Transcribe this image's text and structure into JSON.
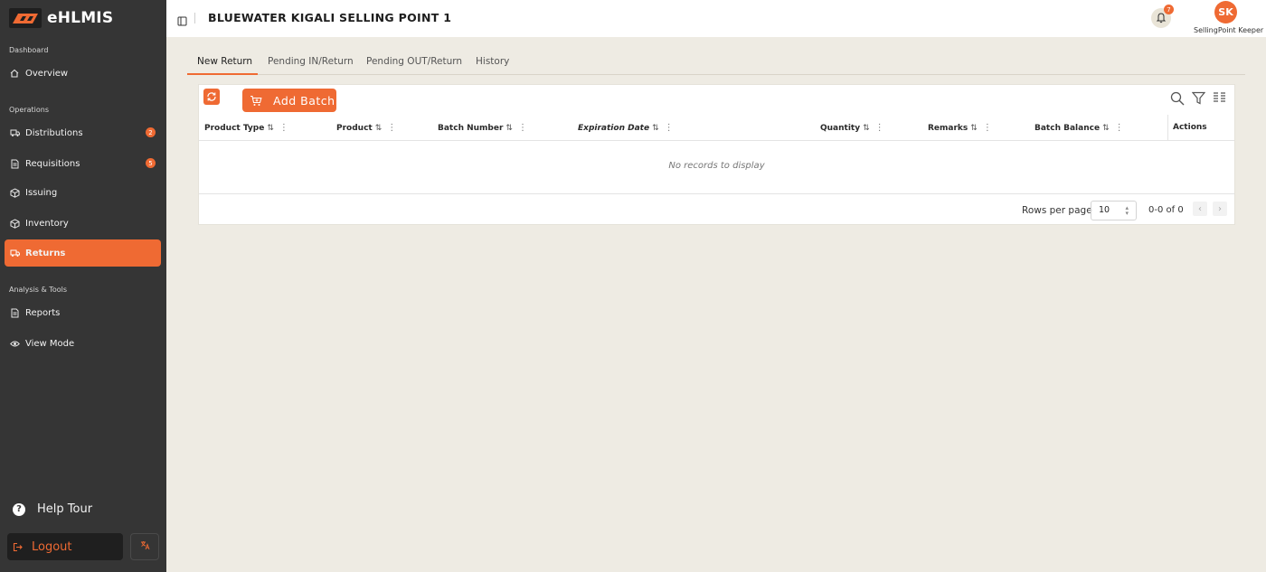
{
  "app": {
    "name": "eHLMIS"
  },
  "sidebar": {
    "sections": [
      {
        "title": "Dashboard"
      },
      {
        "title": "Operations"
      },
      {
        "title": "Analysis & Tools"
      }
    ],
    "items": [
      {
        "label": "Overview",
        "icon": "home-icon"
      },
      {
        "label": "Distributions",
        "icon": "truck-icon",
        "badge": "2"
      },
      {
        "label": "Requisitions",
        "icon": "document-icon",
        "badge": "5"
      },
      {
        "label": "Issuing",
        "icon": "box-icon"
      },
      {
        "label": "Inventory",
        "icon": "box-icon"
      },
      {
        "label": "Returns",
        "icon": "truck-icon",
        "active": true
      },
      {
        "label": "Reports",
        "icon": "document-icon"
      },
      {
        "label": "View Mode",
        "icon": "eye-icon"
      }
    ],
    "help_tour": "Help Tour",
    "logout": "Logout"
  },
  "header": {
    "title": "BLUEWATER KIGALI SELLING POINT 1",
    "notifications": "7",
    "avatar_initials": "SK",
    "user_role": "SellingPoint Keeper"
  },
  "tabs": [
    "New Return",
    "Pending IN/Return",
    "Pending OUT/Return",
    "History"
  ],
  "toolbar": {
    "add_batch": "Add Batch"
  },
  "table": {
    "columns": [
      "Product Type",
      "Product",
      "Batch Number",
      "Expiration Date",
      "Quantity",
      "Remarks",
      "Batch Balance"
    ],
    "actions_label": "Actions",
    "empty_message": "No records to display"
  },
  "pagination": {
    "rows_per_page_label": "Rows per page",
    "rows_per_page": "10",
    "range": "0-0 of 0"
  },
  "colors": {
    "accent": "#ef6a33",
    "sidebar": "#353535",
    "background": "#eeebe3"
  }
}
